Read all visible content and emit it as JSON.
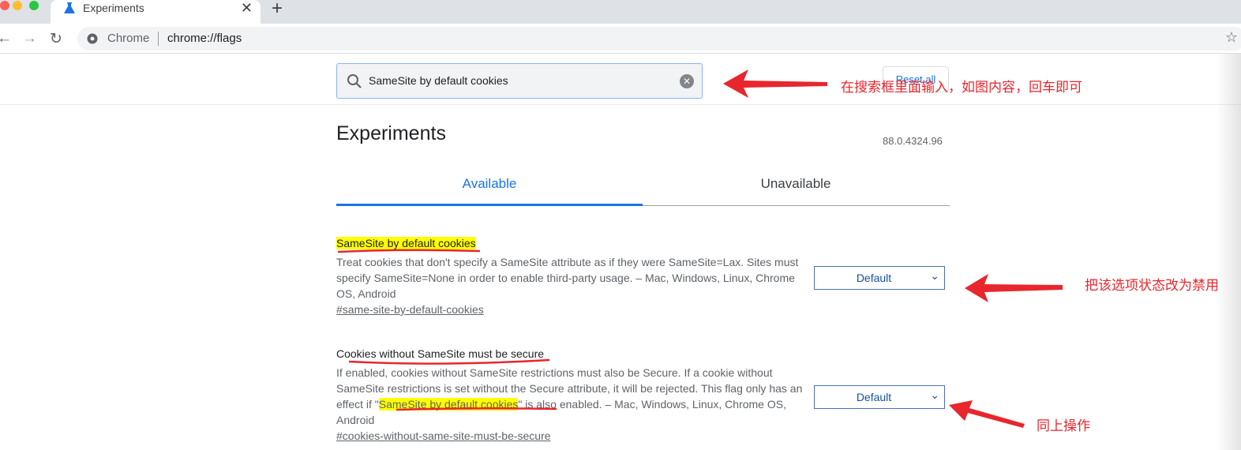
{
  "browser": {
    "tab_title": "Experiments",
    "tab_close": "✕",
    "new_tab": "+",
    "omnibox_site": "Chrome",
    "omnibox_url": "chrome://flags"
  },
  "search": {
    "query": "SameSite by default cookies",
    "reset_label": "Reset all"
  },
  "page": {
    "title": "Experiments",
    "version": "88.0.4324.96",
    "tabs": [
      {
        "label": "Available",
        "active": true
      },
      {
        "label": "Unavailable",
        "active": false
      }
    ]
  },
  "flags": [
    {
      "name": "SameSite by default cookies",
      "description": "Treat cookies that don't specify a SameSite attribute as if they were SameSite=Lax. Sites must specify SameSite=None in order to enable third-party usage. – Mac, Windows, Linux, Chrome OS, Android",
      "link": "#same-site-by-default-cookies",
      "select_value": "Default"
    },
    {
      "name": "Cookies without SameSite must be secure",
      "description_before": "If enabled, cookies without SameSite restrictions must also be Secure. If a cookie without SameSite restrictions is set without the Secure attribute, it will be rejected. This flag only has an effect if \"",
      "description_highlight": "SameSite by default cookies",
      "description_after": "\" is also enabled. – Mac, Windows, Linux, Chrome OS, Android",
      "link": "#cookies-without-same-site-must-be-secure",
      "select_value": "Default"
    }
  ],
  "annotations": {
    "search_hint": "在搜索框里面输入，如图内容，回车即可",
    "flag1_hint": "把该选项状态改为禁用",
    "flag2_hint": "同上操作",
    "color": "#e8262d"
  },
  "colors": {
    "accent": "#1a73e8",
    "highlight": "#ffff00"
  }
}
